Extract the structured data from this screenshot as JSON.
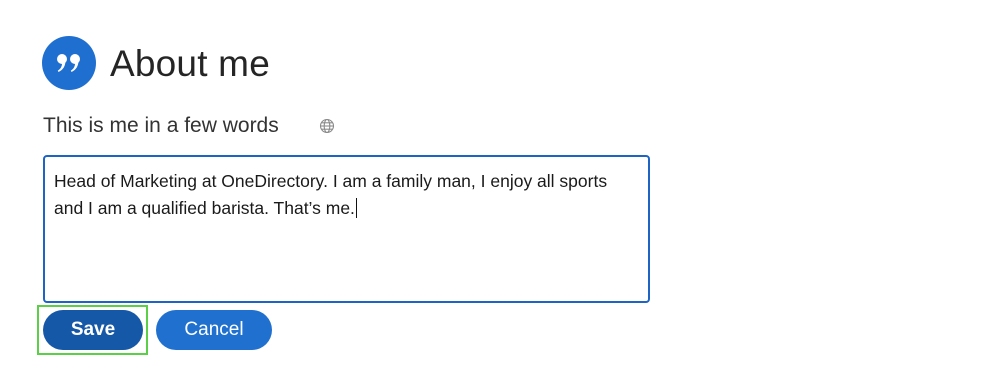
{
  "section": {
    "title": "About me",
    "icon": "quote-icon",
    "accent_color": "#1f6fd0"
  },
  "about_field": {
    "label": "This is me in a few words",
    "visibility_icon": "globe-icon",
    "value": "Head of Marketing at OneDirectory. I am a family man, I enjoy all sports and I am a qualified barista. That’s me."
  },
  "actions": {
    "save_label": "Save",
    "cancel_label": "Cancel",
    "focused": "save",
    "focus_color": "#5ccf48"
  }
}
